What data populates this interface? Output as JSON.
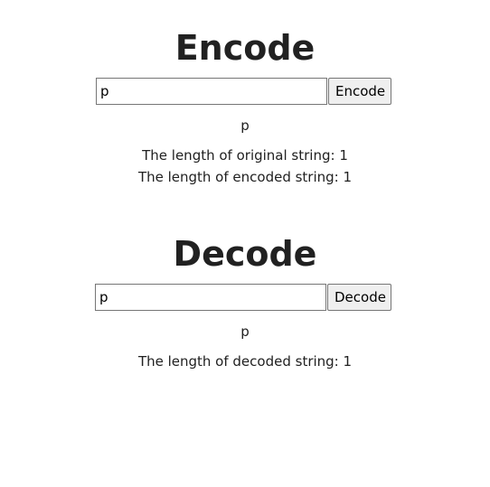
{
  "encode": {
    "title": "Encode",
    "input_value": "p",
    "button_label": "Encode",
    "output": "p",
    "original_length_text": "The length of original string: 1",
    "encoded_length_text": "The length of encoded string: 1"
  },
  "decode": {
    "title": "Decode",
    "input_value": "p",
    "button_label": "Decode",
    "output": "p",
    "decoded_length_text": "The length of decoded string: 1"
  }
}
